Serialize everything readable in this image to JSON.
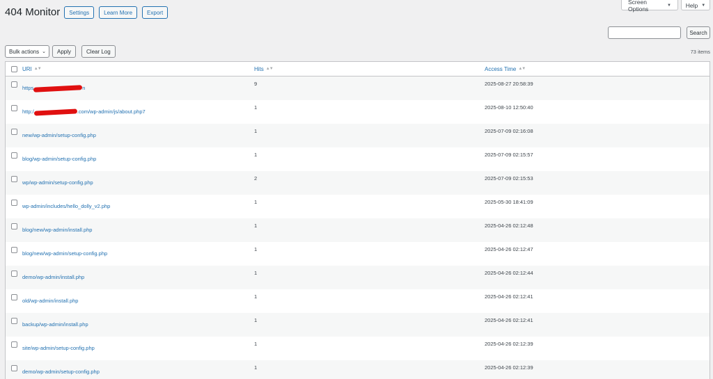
{
  "top_tabs": {
    "screen_options": "Screen Options",
    "help": "Help"
  },
  "header": {
    "title": "404 Monitor",
    "buttons": [
      "Settings",
      "Learn More",
      "Export"
    ]
  },
  "search": {
    "value": "",
    "placeholder": "",
    "button": "Search"
  },
  "tablenav": {
    "bulk_actions": "Bulk actions",
    "apply": "Apply",
    "clear_log": "Clear Log",
    "items_count": "73 items"
  },
  "table": {
    "columns": [
      "URI",
      "Hits",
      "Access Time"
    ],
    "rows": [
      {
        "uri_prefix": "https",
        "uri_suffix": "n",
        "redacted": true,
        "hits": "9",
        "time": "2025-08-27 20:58:39"
      },
      {
        "uri_prefix": "http:/",
        "uri_suffix": ".com/wp-admin/js/about.php7",
        "redacted": true,
        "hits": "1",
        "time": "2025-08-10 12:50:40"
      },
      {
        "uri_prefix": "new/wp-admin/setup-config.php",
        "uri_suffix": "",
        "redacted": false,
        "hits": "1",
        "time": "2025-07-09 02:16:08"
      },
      {
        "uri_prefix": "blog/wp-admin/setup-config.php",
        "uri_suffix": "",
        "redacted": false,
        "hits": "1",
        "time": "2025-07-09 02:15:57"
      },
      {
        "uri_prefix": "wp/wp-admin/setup-config.php",
        "uri_suffix": "",
        "redacted": false,
        "hits": "2",
        "time": "2025-07-09 02:15:53"
      },
      {
        "uri_prefix": "wp-admin/includes/hello_dolly_v2.php",
        "uri_suffix": "",
        "redacted": false,
        "hits": "1",
        "time": "2025-05-30 18:41:09"
      },
      {
        "uri_prefix": "blog/new/wp-admin/install.php",
        "uri_suffix": "",
        "redacted": false,
        "hits": "1",
        "time": "2025-04-26 02:12:48"
      },
      {
        "uri_prefix": "blog/new/wp-admin/setup-config.php",
        "uri_suffix": "",
        "redacted": false,
        "hits": "1",
        "time": "2025-04-26 02:12:47"
      },
      {
        "uri_prefix": "demo/wp-admin/install.php",
        "uri_suffix": "",
        "redacted": false,
        "hits": "1",
        "time": "2025-04-26 02:12:44"
      },
      {
        "uri_prefix": "old/wp-admin/install.php",
        "uri_suffix": "",
        "redacted": false,
        "hits": "1",
        "time": "2025-04-26 02:12:41"
      },
      {
        "uri_prefix": "backup/wp-admin/install.php",
        "uri_suffix": "",
        "redacted": false,
        "hits": "1",
        "time": "2025-04-26 02:12:41"
      },
      {
        "uri_prefix": "site/wp-admin/setup-config.php",
        "uri_suffix": "",
        "redacted": false,
        "hits": "1",
        "time": "2025-04-26 02:12:39"
      },
      {
        "uri_prefix": "demo/wp-admin/setup-config.php",
        "uri_suffix": "",
        "redacted": false,
        "hits": "1",
        "time": "2025-04-26 02:12:39"
      }
    ]
  },
  "colors": {
    "link": "#2271b1",
    "redaction": "#e01010",
    "background": "#f0f0f1"
  }
}
